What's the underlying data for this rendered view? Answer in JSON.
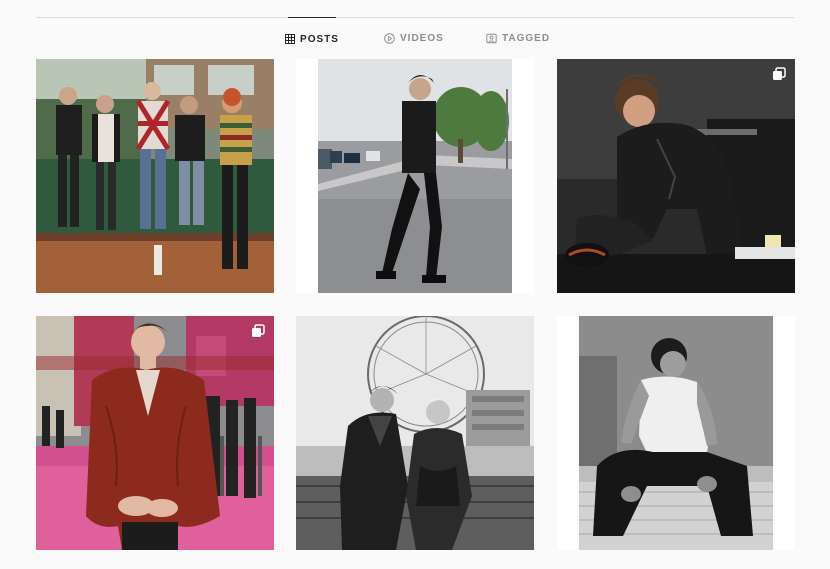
{
  "tabs": [
    {
      "label": "POSTS",
      "icon": "grid-icon",
      "active": true
    },
    {
      "label": "VIDEOS",
      "icon": "play-circle-icon",
      "active": false
    },
    {
      "label": "TAGGED",
      "icon": "tag-icon",
      "active": false
    }
  ],
  "posts": [
    {
      "description": "band-group-photo",
      "multiple": false
    },
    {
      "description": "street-walking-photo",
      "multiple": false
    },
    {
      "description": "leather-jacket-stage-photo",
      "multiple": true
    },
    {
      "description": "red-leather-coat-carpet-photo",
      "multiple": true
    },
    {
      "description": "ferris-wheel-couple-photo",
      "multiple": false
    },
    {
      "description": "bedroom-portrait-photo",
      "multiple": false
    }
  ],
  "colors": {
    "active_tab": "#262626",
    "inactive_tab": "#8e8e8e",
    "divider": "#dbdbdb",
    "background": "#fafafa"
  }
}
